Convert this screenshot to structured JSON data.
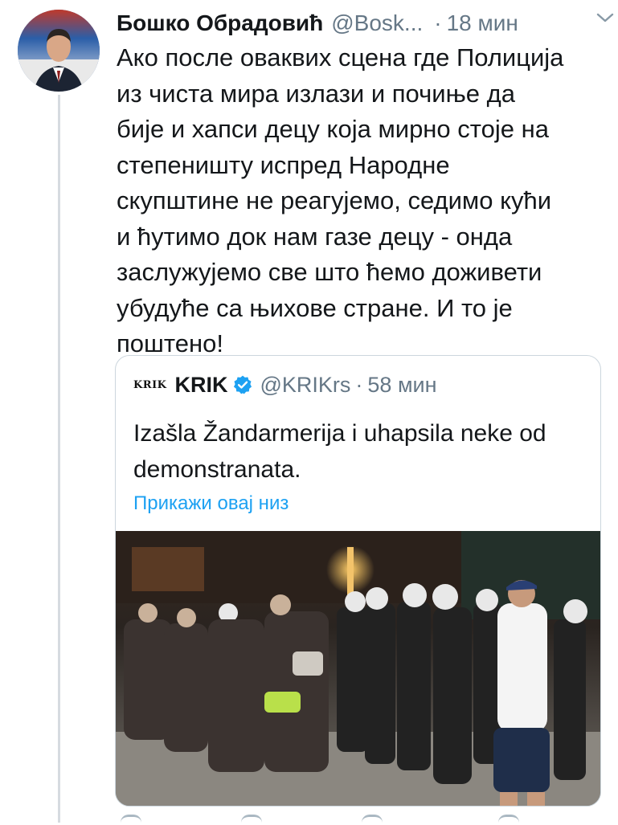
{
  "tweet": {
    "author_name": "Бошко Обрадовић",
    "author_handle": "@Bosk...",
    "separator": "·",
    "time": "18 мин",
    "text": "Ако после оваквих сцена где Полиција\nиз чиста мира излази и почиње да\nбије и хапси децу која мирно стоје на\nстепеништу испред Народне\nскупштине не реагујемо, седимо кући\nи ћутимо док нам газе децу - онда\nзаслужујемо све што ћемо доживети\nубудуће са њихове стране. И то је\nпоштено!",
    "menu_icon": "chevron-down-icon"
  },
  "quote": {
    "logo_text": "KRIK",
    "name": "KRIK",
    "verified_icon": "verified-badge-icon",
    "handle": "@KRIKrs",
    "separator": "·",
    "time": "58 мин",
    "text": "Izašla Žandarmerija i uhapsila neke od demonstranata.",
    "show_thread": "Прикажи овај низ"
  },
  "colors": {
    "link": "#1da1f2",
    "secondary_text": "#657786",
    "border": "#ccd6dd",
    "thread_line": "#d6dbe0"
  }
}
